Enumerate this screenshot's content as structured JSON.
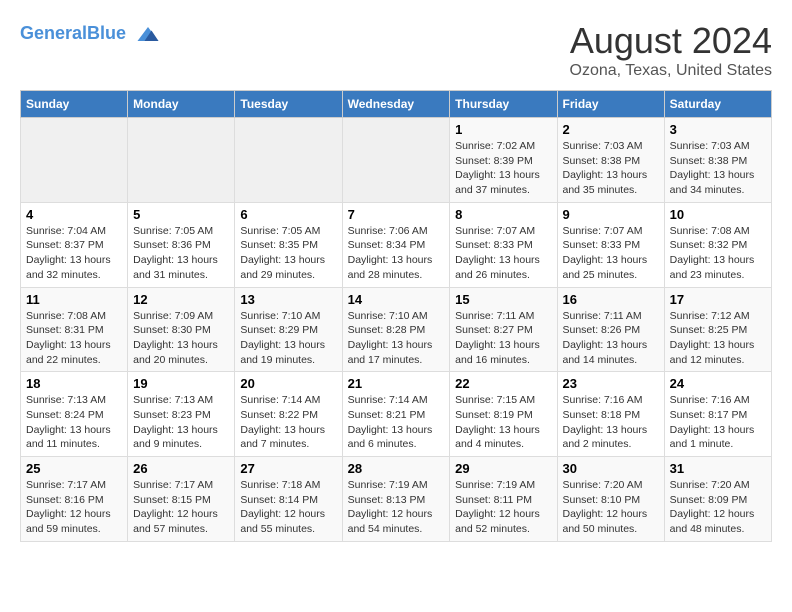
{
  "header": {
    "logo_line1": "General",
    "logo_line2": "Blue",
    "main_title": "August 2024",
    "subtitle": "Ozona, Texas, United States"
  },
  "weekdays": [
    "Sunday",
    "Monday",
    "Tuesday",
    "Wednesday",
    "Thursday",
    "Friday",
    "Saturday"
  ],
  "weeks": [
    [
      {
        "day": "",
        "info": ""
      },
      {
        "day": "",
        "info": ""
      },
      {
        "day": "",
        "info": ""
      },
      {
        "day": "",
        "info": ""
      },
      {
        "day": "1",
        "info": "Sunrise: 7:02 AM\nSunset: 8:39 PM\nDaylight: 13 hours\nand 37 minutes."
      },
      {
        "day": "2",
        "info": "Sunrise: 7:03 AM\nSunset: 8:38 PM\nDaylight: 13 hours\nand 35 minutes."
      },
      {
        "day": "3",
        "info": "Sunrise: 7:03 AM\nSunset: 8:38 PM\nDaylight: 13 hours\nand 34 minutes."
      }
    ],
    [
      {
        "day": "4",
        "info": "Sunrise: 7:04 AM\nSunset: 8:37 PM\nDaylight: 13 hours\nand 32 minutes."
      },
      {
        "day": "5",
        "info": "Sunrise: 7:05 AM\nSunset: 8:36 PM\nDaylight: 13 hours\nand 31 minutes."
      },
      {
        "day": "6",
        "info": "Sunrise: 7:05 AM\nSunset: 8:35 PM\nDaylight: 13 hours\nand 29 minutes."
      },
      {
        "day": "7",
        "info": "Sunrise: 7:06 AM\nSunset: 8:34 PM\nDaylight: 13 hours\nand 28 minutes."
      },
      {
        "day": "8",
        "info": "Sunrise: 7:07 AM\nSunset: 8:33 PM\nDaylight: 13 hours\nand 26 minutes."
      },
      {
        "day": "9",
        "info": "Sunrise: 7:07 AM\nSunset: 8:33 PM\nDaylight: 13 hours\nand 25 minutes."
      },
      {
        "day": "10",
        "info": "Sunrise: 7:08 AM\nSunset: 8:32 PM\nDaylight: 13 hours\nand 23 minutes."
      }
    ],
    [
      {
        "day": "11",
        "info": "Sunrise: 7:08 AM\nSunset: 8:31 PM\nDaylight: 13 hours\nand 22 minutes."
      },
      {
        "day": "12",
        "info": "Sunrise: 7:09 AM\nSunset: 8:30 PM\nDaylight: 13 hours\nand 20 minutes."
      },
      {
        "day": "13",
        "info": "Sunrise: 7:10 AM\nSunset: 8:29 PM\nDaylight: 13 hours\nand 19 minutes."
      },
      {
        "day": "14",
        "info": "Sunrise: 7:10 AM\nSunset: 8:28 PM\nDaylight: 13 hours\nand 17 minutes."
      },
      {
        "day": "15",
        "info": "Sunrise: 7:11 AM\nSunset: 8:27 PM\nDaylight: 13 hours\nand 16 minutes."
      },
      {
        "day": "16",
        "info": "Sunrise: 7:11 AM\nSunset: 8:26 PM\nDaylight: 13 hours\nand 14 minutes."
      },
      {
        "day": "17",
        "info": "Sunrise: 7:12 AM\nSunset: 8:25 PM\nDaylight: 13 hours\nand 12 minutes."
      }
    ],
    [
      {
        "day": "18",
        "info": "Sunrise: 7:13 AM\nSunset: 8:24 PM\nDaylight: 13 hours\nand 11 minutes."
      },
      {
        "day": "19",
        "info": "Sunrise: 7:13 AM\nSunset: 8:23 PM\nDaylight: 13 hours\nand 9 minutes."
      },
      {
        "day": "20",
        "info": "Sunrise: 7:14 AM\nSunset: 8:22 PM\nDaylight: 13 hours\nand 7 minutes."
      },
      {
        "day": "21",
        "info": "Sunrise: 7:14 AM\nSunset: 8:21 PM\nDaylight: 13 hours\nand 6 minutes."
      },
      {
        "day": "22",
        "info": "Sunrise: 7:15 AM\nSunset: 8:19 PM\nDaylight: 13 hours\nand 4 minutes."
      },
      {
        "day": "23",
        "info": "Sunrise: 7:16 AM\nSunset: 8:18 PM\nDaylight: 13 hours\nand 2 minutes."
      },
      {
        "day": "24",
        "info": "Sunrise: 7:16 AM\nSunset: 8:17 PM\nDaylight: 13 hours\nand 1 minute."
      }
    ],
    [
      {
        "day": "25",
        "info": "Sunrise: 7:17 AM\nSunset: 8:16 PM\nDaylight: 12 hours\nand 59 minutes."
      },
      {
        "day": "26",
        "info": "Sunrise: 7:17 AM\nSunset: 8:15 PM\nDaylight: 12 hours\nand 57 minutes."
      },
      {
        "day": "27",
        "info": "Sunrise: 7:18 AM\nSunset: 8:14 PM\nDaylight: 12 hours\nand 55 minutes."
      },
      {
        "day": "28",
        "info": "Sunrise: 7:19 AM\nSunset: 8:13 PM\nDaylight: 12 hours\nand 54 minutes."
      },
      {
        "day": "29",
        "info": "Sunrise: 7:19 AM\nSunset: 8:11 PM\nDaylight: 12 hours\nand 52 minutes."
      },
      {
        "day": "30",
        "info": "Sunrise: 7:20 AM\nSunset: 8:10 PM\nDaylight: 12 hours\nand 50 minutes."
      },
      {
        "day": "31",
        "info": "Sunrise: 7:20 AM\nSunset: 8:09 PM\nDaylight: 12 hours\nand 48 minutes."
      }
    ]
  ]
}
